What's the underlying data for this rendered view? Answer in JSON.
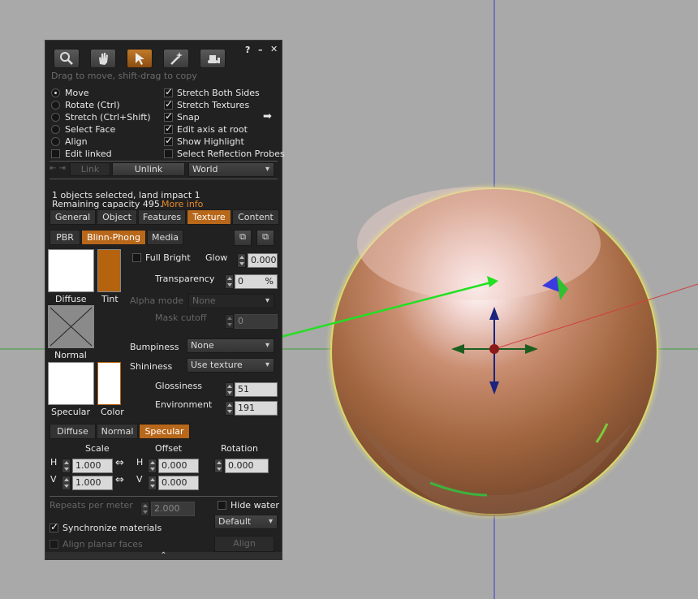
{
  "panel": {
    "close_glyph": "✕",
    "help_glyph": "?",
    "minimize_glyph": "–",
    "hint": "Drag to move, shift-drag to copy",
    "modes": [
      {
        "label": "Move",
        "selected": true
      },
      {
        "label": "Rotate (Ctrl)",
        "selected": false
      },
      {
        "label": "Stretch (Ctrl+Shift)",
        "selected": false
      },
      {
        "label": "Select Face",
        "selected": false
      },
      {
        "label": "Align",
        "selected": false
      }
    ],
    "edit_linked": {
      "label": "Edit linked",
      "checked": false
    },
    "options": [
      {
        "label": "Stretch Both Sides",
        "checked": true
      },
      {
        "label": "Stretch Textures",
        "checked": true
      },
      {
        "label": "Snap",
        "checked": true
      },
      {
        "label": "Edit axis at root",
        "checked": true
      },
      {
        "label": "Show Highlight",
        "checked": true
      },
      {
        "label": "Select Reflection Probes",
        "checked": false
      }
    ],
    "link_label": "Link",
    "unlink_label": "Unlink",
    "world_dropdown": "World",
    "selection_info": "1 objects selected, land impact 1",
    "remaining_capacity": "Remaining capacity 495.",
    "more_info": "More info",
    "tabs": [
      "General",
      "Object",
      "Features",
      "Texture",
      "Content"
    ],
    "active_tab": "Texture",
    "material_tabs": [
      "PBR",
      "Blinn-Phong",
      "Media"
    ],
    "active_material_tab": "Blinn-Phong",
    "diffuse_label": "Diffuse",
    "tint_label": "Tint",
    "normal_label": "Normal",
    "specular_label": "Specular",
    "color_label": "Color",
    "full_bright": {
      "label": "Full Bright",
      "checked": false
    },
    "glow_label": "Glow",
    "glow_value": "0.000",
    "transparency_label": "Transparency",
    "transparency_value": "0",
    "transparency_unit": "%",
    "alpha_mode_label": "Alpha mode",
    "alpha_mode_value": "None",
    "mask_cutoff_label": "Mask cutoff",
    "mask_cutoff_value": "0",
    "bumpiness_label": "Bumpiness",
    "bumpiness_value": "None",
    "shininess_label": "Shininess",
    "shininess_value": "Use texture",
    "glossiness_label": "Glossiness",
    "glossiness_value": "51",
    "environment_label": "Environment",
    "environment_value": "191",
    "map_tabs": [
      "Diffuse",
      "Normal",
      "Specular"
    ],
    "active_map_tab": "Specular",
    "scale_label": "Scale",
    "offset_label": "Offset",
    "rotation_label": "Rotation",
    "h_label": "H",
    "v_label": "V",
    "scale_h": "1.000",
    "scale_v": "1.000",
    "offset_h": "0.000",
    "offset_v": "0.000",
    "rotation": "0.000",
    "repeats_label": "Repeats per meter",
    "repeats_value": "2.000",
    "hide_water": {
      "label": "Hide water",
      "checked": false
    },
    "default_dropdown": "Default",
    "sync_materials": {
      "label": "Synchronize materials",
      "checked": true
    },
    "align_planar": {
      "label": "Align planar faces",
      "checked": false
    },
    "align_button": "Align",
    "collapse_glyph": "⌃"
  },
  "colors": {
    "accent": "#b8681a",
    "tint_swatch": "#b5630f",
    "background": "#a9a9a9",
    "sphere_base": "#b87a5a",
    "sphere_outline": "#d8d86a"
  }
}
